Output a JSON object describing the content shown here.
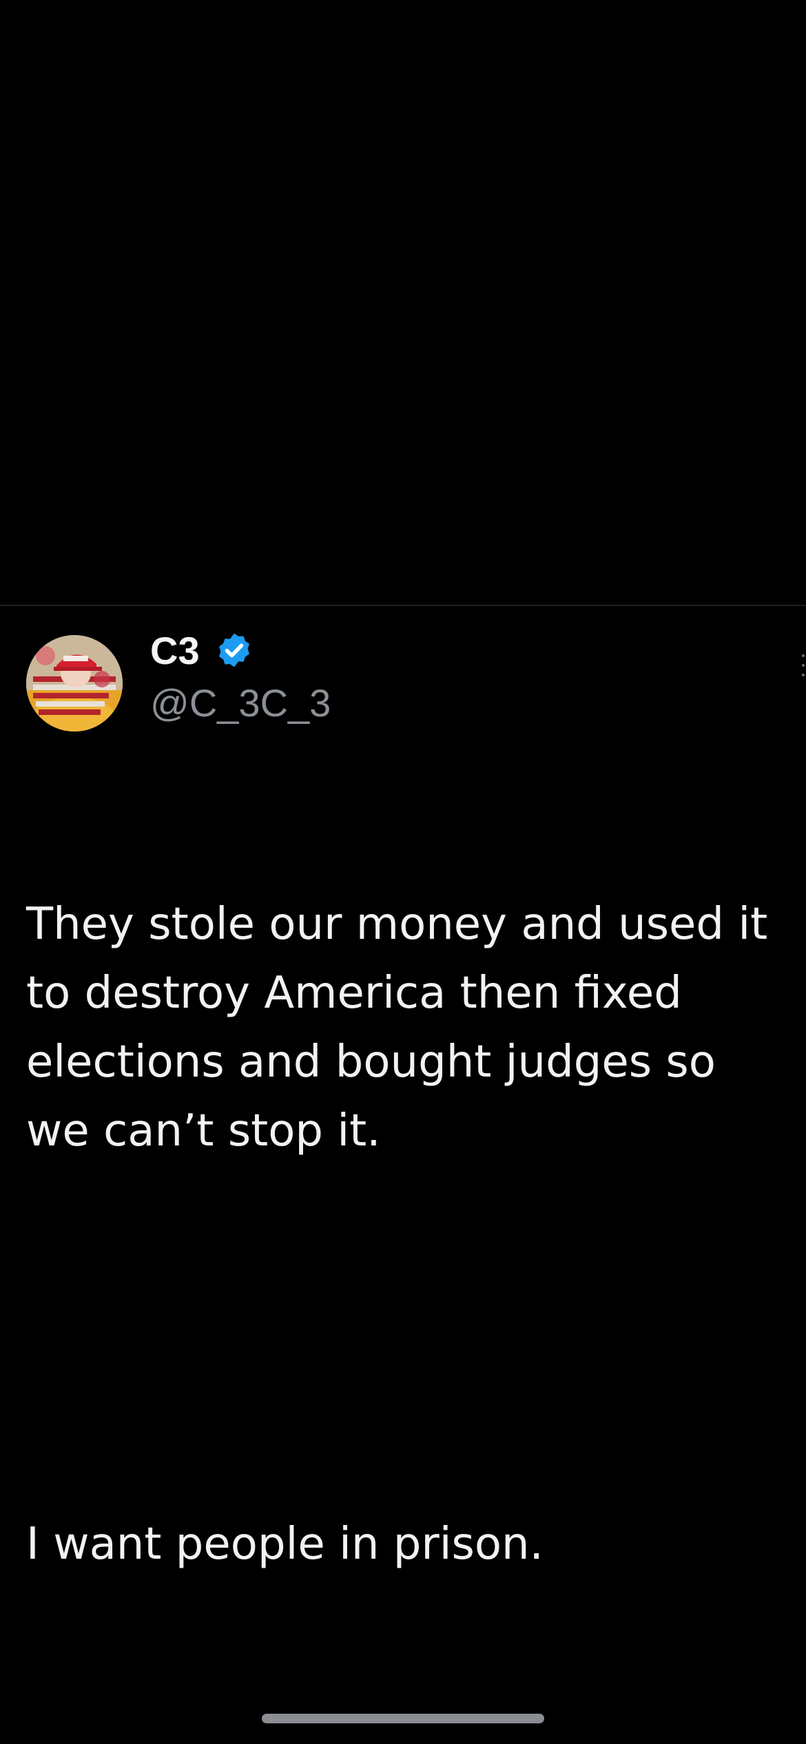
{
  "tweet": {
    "author": {
      "display_name": "C3",
      "handle": "@C_3C_3",
      "verified": true,
      "verified_icon": "verified-badge-icon",
      "avatar_icon": "profile-avatar"
    },
    "text_paragraph_1": "They stole our money and used it to destroy America then fixed elections and bought judges so we can’t stop it.",
    "text_paragraph_2": "I want people in prison."
  },
  "colors": {
    "background": "#000000",
    "text_primary": "#f2f2f2",
    "text_secondary": "#8b9096",
    "verified_blue": "#1d9bf0",
    "divider": "#1c1f22"
  }
}
